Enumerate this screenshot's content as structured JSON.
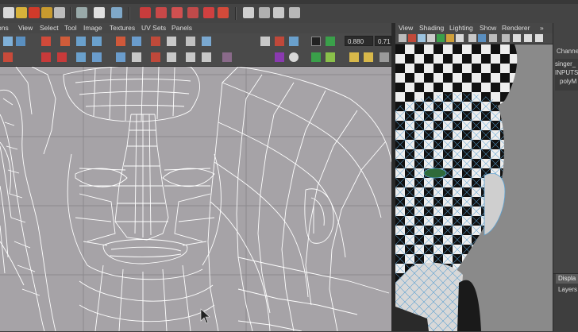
{
  "colors": {
    "uv_background": "#a6a3a7",
    "wireframe": "#ffffff",
    "grid_line": "#8c8a8e",
    "panel_background": "#444444",
    "selection_highlight": "#5aa0d0"
  },
  "uv_editor": {
    "menu": [
      "ons",
      "View",
      "Select",
      "Tool",
      "Image",
      "Textures",
      "UV Sets",
      "Panels"
    ],
    "fields": {
      "value_1": "0.880",
      "value_2": "0.71"
    }
  },
  "viewport": {
    "menu": [
      "View",
      "Shading",
      "Lighting",
      "Show",
      "Renderer"
    ],
    "overflow_glyph": "»"
  },
  "channel_box": {
    "title": "Channel",
    "object_name": "singer_",
    "inputs_label": "INPUTS",
    "input_node": "polyM",
    "display_tab": "Displa",
    "layers_menu": "Layers"
  },
  "icons": [
    "new-scene-icon",
    "open-scene-icon",
    "save-scene-icon",
    "select-tool-icon",
    "lasso-icon",
    "move-tool-icon",
    "rotate-tool-icon",
    "scale-tool-icon",
    "snap-grid-icon",
    "snap-curve-icon",
    "snap-point-icon",
    "render-icon",
    "ipr-render-icon",
    "render-settings-icon",
    "uv-flip-icon",
    "uv-rotate-icon",
    "uv-cut-icon",
    "uv-sew-icon",
    "uv-layout-icon",
    "checker-icon",
    "grid-toggle-icon",
    "shaded-uv-icon"
  ]
}
